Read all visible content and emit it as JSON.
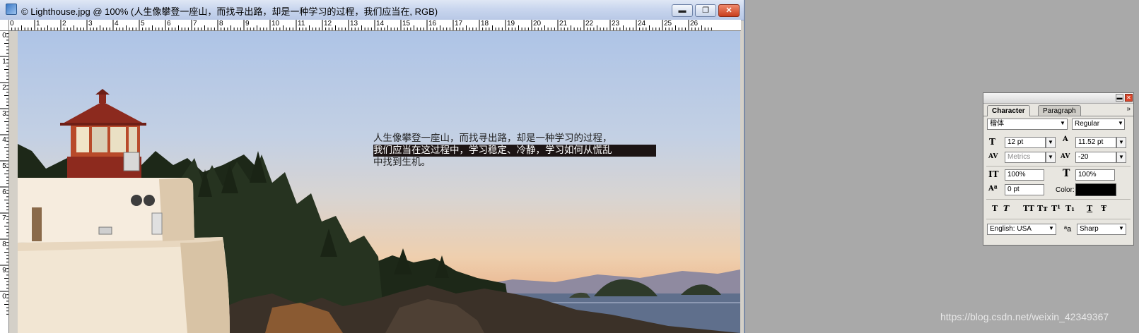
{
  "window": {
    "title": "© Lighthouse.jpg @ 100% (人生像攀登一座山，而找寻出路，却是一种学习的过程，我们应当在, RGB)",
    "minimize_glyph": "▬",
    "restore_glyph": "❐",
    "close_glyph": "✕"
  },
  "ruler": {
    "horizontal": [
      "0",
      "1",
      "2",
      "3",
      "4",
      "5",
      "6",
      "7",
      "8",
      "9",
      "10",
      "11",
      "12",
      "13",
      "14",
      "15",
      "16",
      "17",
      "18",
      "19",
      "20",
      "21",
      "22",
      "23",
      "24",
      "25",
      "26"
    ],
    "vertical": [
      "0",
      "1",
      "2",
      "3",
      "4",
      "5",
      "6",
      "7",
      "8",
      "9",
      "0"
    ]
  },
  "canvas": {
    "text_lines": [
      "人生像攀登一座山，而找寻出路，却是一种学习的过程，",
      "我们应当在这过程中，学习稳定、冷静，学习如何从慌乱",
      "中找到生机。"
    ]
  },
  "watermark": "https://blog.csdn.net/weixin_42349367",
  "character_panel": {
    "tabs": [
      "Character",
      "Paragraph"
    ],
    "menu_glyph": "»",
    "font_family": "楷体",
    "font_style": "Regular",
    "font_size": "12 pt",
    "leading": "11.52 pt",
    "kerning": "Metrics",
    "tracking": "-20",
    "vertical_scale": "100%",
    "horizontal_scale": "100%",
    "baseline_shift": "0 pt",
    "color_label": "Color:",
    "color_value": "#000000",
    "language": "English: USA",
    "antialias": "Sharp",
    "antialias_icon_text": "ªa",
    "size_icon_text": "T",
    "leading_icon_text": "A",
    "kern_icon_text": "AV",
    "track_icon_text": "AV",
    "vscale_icon_text": "IT",
    "hscale_icon_text": "T",
    "baseline_icon_text": "Aª",
    "style_buttons": [
      "T",
      "T",
      "TT",
      "Tт",
      "T¹",
      "T₁",
      "T",
      "Ŧ"
    ]
  }
}
